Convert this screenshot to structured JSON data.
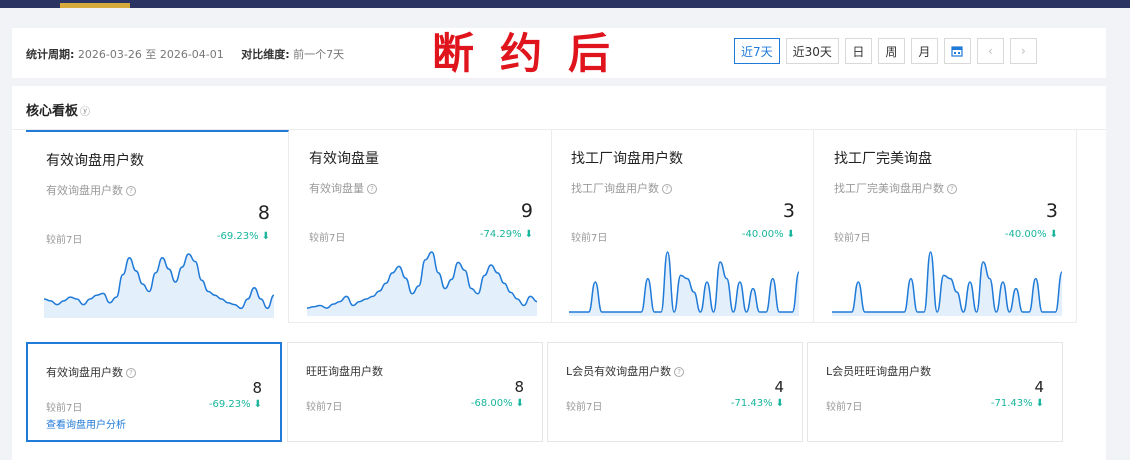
{
  "filter": {
    "period_label": "统计周期:",
    "period_value": "2026-03-26 至 2026-04-01",
    "compare_label": "对比维度:",
    "compare_value": "前一个7天",
    "buttons": [
      "近7天",
      "近30天",
      "日",
      "周",
      "月"
    ],
    "active_button": "近7天"
  },
  "stamp_text": "断约后",
  "dashboard": {
    "title": "核心看板",
    "cards": [
      {
        "title": "有效询盘用户数",
        "subtitle": "有效询盘用户数",
        "value": "8",
        "compare_label": "较前7日",
        "change": "-69.23%",
        "sparkline": [
          8,
          7,
          5,
          7,
          9,
          8,
          5,
          8,
          10,
          11,
          6,
          9,
          21,
          30,
          23,
          16,
          12,
          22,
          30,
          24,
          17,
          25,
          32,
          28,
          18,
          12,
          10,
          8,
          6,
          5,
          3,
          8,
          14,
          8,
          3,
          10
        ]
      },
      {
        "title": "有效询盘量",
        "subtitle": "有效询盘量",
        "value": "9",
        "compare_label": "较前7日",
        "change": "-74.29%",
        "sparkline": [
          3,
          4,
          5,
          3,
          6,
          8,
          12,
          5,
          8,
          10,
          12,
          16,
          22,
          30,
          35,
          26,
          14,
          20,
          40,
          46,
          30,
          18,
          25,
          38,
          32,
          18,
          14,
          28,
          36,
          30,
          22,
          15,
          10,
          5,
          12,
          8
        ]
      },
      {
        "title": "找工厂询盘用户数",
        "subtitle": "找工厂询盘用户数",
        "value": "3",
        "compare_label": "较前7日",
        "change": "-40.00%",
        "sparkline": [
          0,
          0,
          0,
          0,
          18,
          0,
          0,
          0,
          0,
          0,
          0,
          0,
          20,
          0,
          0,
          36,
          0,
          22,
          20,
          12,
          0,
          18,
          0,
          30,
          20,
          0,
          18,
          0,
          14,
          0,
          0,
          20,
          0,
          0,
          0,
          24
        ]
      },
      {
        "title": "找工厂完美询盘",
        "subtitle": "找工厂完美询盘用户数",
        "value": "3",
        "compare_label": "较前7日",
        "change": "-40.00%",
        "sparkline": [
          0,
          0,
          0,
          0,
          18,
          0,
          0,
          0,
          0,
          0,
          0,
          0,
          20,
          0,
          0,
          36,
          0,
          22,
          20,
          12,
          0,
          18,
          0,
          30,
          20,
          0,
          18,
          0,
          14,
          0,
          0,
          20,
          0,
          0,
          0,
          24
        ]
      }
    ],
    "minis": [
      {
        "title": "有效询盘用户数",
        "help": true,
        "value": "8",
        "compare_label": "较前7日",
        "change": "-69.23%",
        "link": "查看询盘用户分析"
      },
      {
        "title": "旺旺询盘用户数",
        "help": false,
        "value": "8",
        "compare_label": "较前7日",
        "change": "-68.00%"
      },
      {
        "title": "L会员有效询盘用户数",
        "help": true,
        "value": "4",
        "compare_label": "较前7日",
        "change": "-71.43%"
      },
      {
        "title": "L会员旺旺询盘用户数",
        "help": false,
        "value": "4",
        "compare_label": "较前7日",
        "change": "-71.43%"
      }
    ]
  },
  "colors": {
    "accent": "#1f7ad8",
    "down": "#17b59b",
    "stamp": "#e0141c",
    "sparkline_fill": "#e3effb"
  },
  "icons": {
    "help": "question-circle-icon",
    "down": "arrow-down-icon",
    "calendar": "calendar-icon",
    "prev": "chevron-left-icon",
    "next": "chevron-right-icon"
  }
}
